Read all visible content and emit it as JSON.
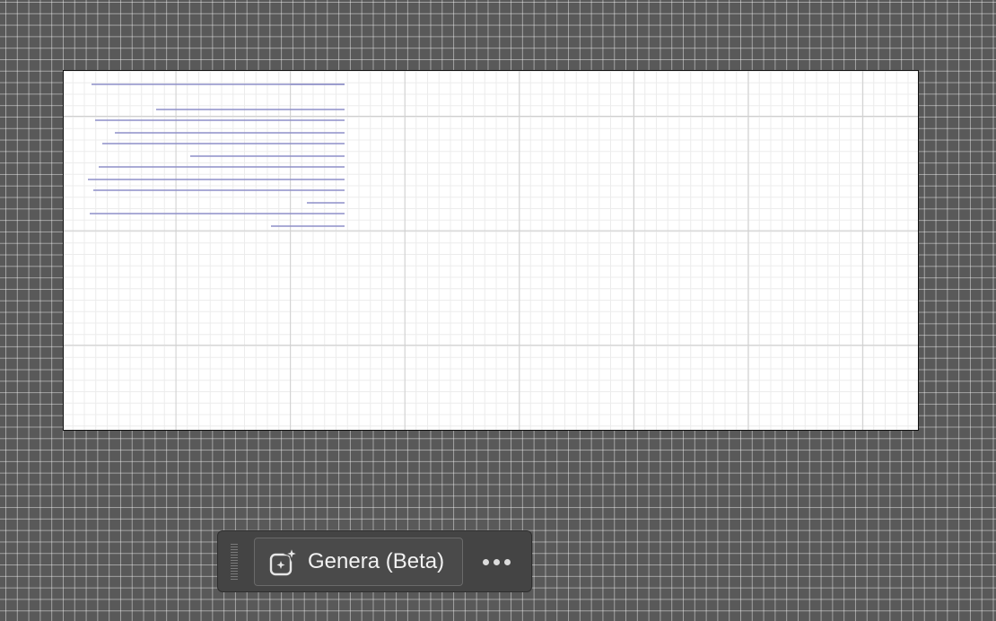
{
  "canvas": {
    "text_frame": {
      "line_color": "#8e8fc8",
      "line_count": 13
    }
  },
  "taskbar": {
    "generate_label": "Genera (Beta)",
    "generate_icon": "sparkle-generate-icon",
    "more_icon": "more-horizontal-icon"
  }
}
